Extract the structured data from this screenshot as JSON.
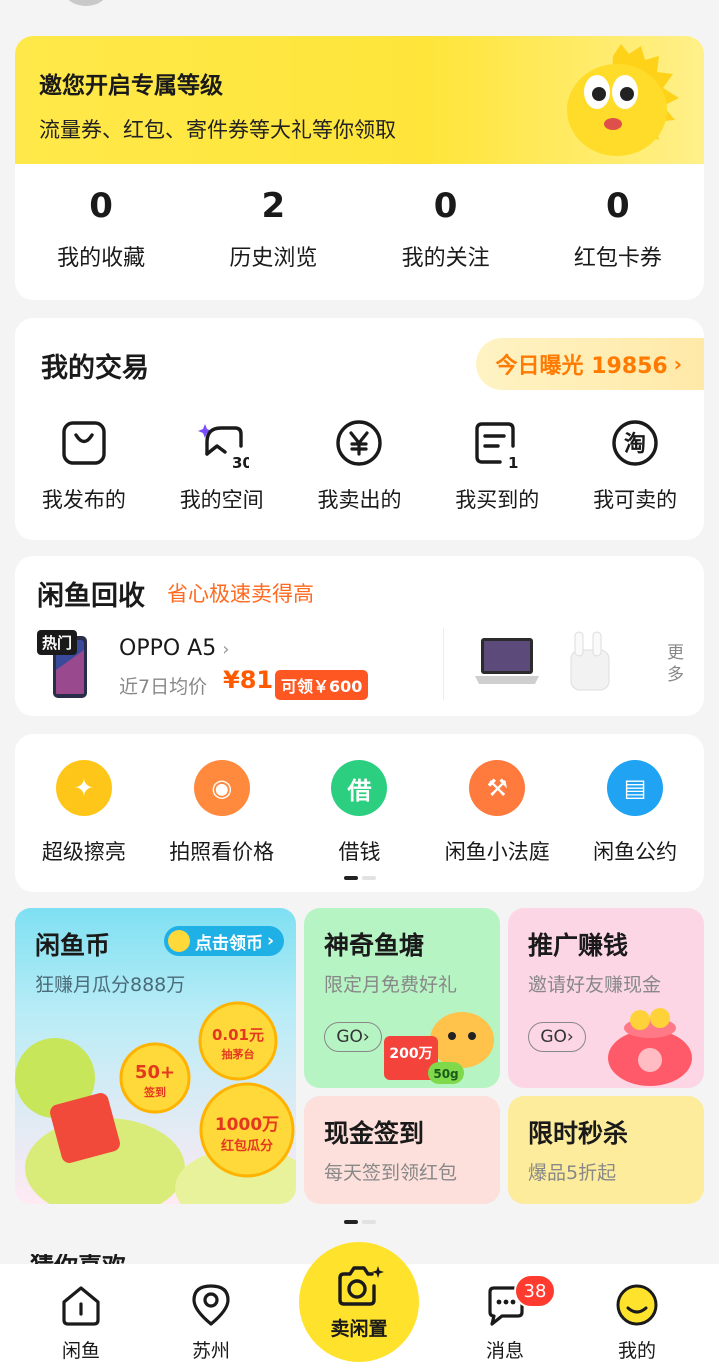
{
  "level_banner": {
    "title": "邀您开启专属等级",
    "subtitle": "流量券、红包、寄件券等大礼等你领取"
  },
  "stats": [
    {
      "value": "0",
      "label": "我的收藏"
    },
    {
      "value": "2",
      "label": "历史浏览"
    },
    {
      "value": "0",
      "label": "我的关注"
    },
    {
      "value": "0",
      "label": "红包卡券"
    }
  ],
  "trade": {
    "title": "我的交易",
    "exposure": "今日曝光 19856",
    "items": [
      {
        "label": "我发布的",
        "icon": "bag-icon"
      },
      {
        "label": "我的空间",
        "icon": "space-icon",
        "count": "30"
      },
      {
        "label": "我卖出的",
        "icon": "yuan-icon"
      },
      {
        "label": "我买到的",
        "icon": "receipt-icon",
        "count": "1"
      },
      {
        "label": "我可卖的",
        "icon": "tao-icon",
        "glyph": "淘"
      }
    ]
  },
  "recycle": {
    "title": "闲鱼回收",
    "subtitle": "省心极速卖得高",
    "hot_tag": "热门",
    "model": "OPPO A5",
    "avg_label": "近7日均价",
    "avg_price": "¥81",
    "coupon": "可领￥600",
    "more": "更多"
  },
  "tools": [
    {
      "label": "超级擦亮",
      "icon": "sparkle-icon",
      "color": "#ffc61a"
    },
    {
      "label": "拍照看价格",
      "icon": "camera-icon",
      "color": "#ff8a3d"
    },
    {
      "label": "借钱",
      "icon": "borrow-icon",
      "color": "#2bcf7f",
      "glyph": "借"
    },
    {
      "label": "闲鱼小法庭",
      "icon": "gavel-icon",
      "color": "#ff7a3d"
    },
    {
      "label": "闲鱼公约",
      "icon": "pact-icon",
      "color": "#1fa3f2"
    }
  ],
  "promos": {
    "coin": {
      "title": "闲鱼币",
      "button": "点击领币",
      "subtitle": "狂赚月瓜分888万",
      "badge_a": "0.01元",
      "badge_a2": "抽茅台",
      "badge_b": "50+",
      "badge_b2": "签到",
      "badge_c": "1000万",
      "badge_c2": "红包瓜分"
    },
    "pond": {
      "title": "神奇鱼塘",
      "subtitle": "限定月免费好礼",
      "go": "GO",
      "tag_a": "200万",
      "tag_b": "50g"
    },
    "promote": {
      "title": "推广赚钱",
      "subtitle": "邀请好友赚现金",
      "go": "GO"
    },
    "cash": {
      "title": "现金签到",
      "subtitle": "每天签到领红包"
    },
    "flash": {
      "title": "限时秒杀",
      "subtitle": "爆品5折起"
    }
  },
  "peek_text": "猜你喜欢",
  "nav": {
    "home": "闲鱼",
    "city": "苏州",
    "sell": "卖闲置",
    "messages": "消息",
    "messages_badge": "38",
    "me": "我的"
  },
  "colors": {
    "brand_yellow": "#ffe22b",
    "accent_orange": "#ff7a00",
    "badge_red": "#ff3b30"
  }
}
